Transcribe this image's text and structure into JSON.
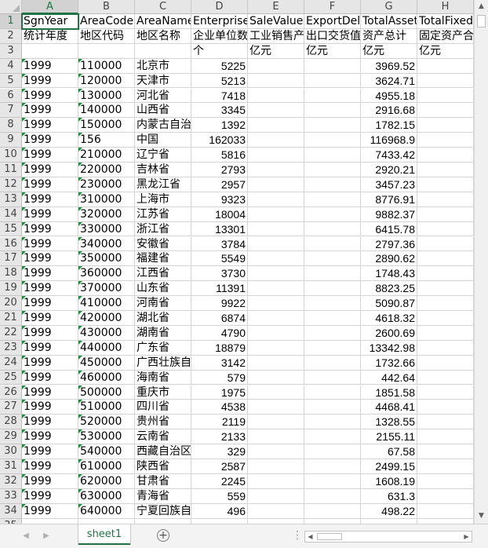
{
  "sheet": {
    "columns": [
      {
        "letter": "A",
        "selected": true
      },
      {
        "letter": "B",
        "selected": false
      },
      {
        "letter": "C",
        "selected": false
      },
      {
        "letter": "D",
        "selected": false
      },
      {
        "letter": "E",
        "selected": false
      },
      {
        "letter": "F",
        "selected": false
      },
      {
        "letter": "G",
        "selected": false
      },
      {
        "letter": "H",
        "selected": false
      }
    ],
    "header_rows": [
      [
        "SgnYear",
        "AreaCode",
        "AreaName",
        "EnterpriseN",
        "SaleValue",
        "ExportDeliv",
        "TotalAsset",
        "TotalFixed"
      ],
      [
        "统计年度",
        "地区代码",
        "地区名称",
        "企业单位数",
        "工业销售产",
        "出口交货值",
        "资产总计",
        "固定资产合"
      ],
      [
        "",
        "",
        "",
        "个",
        "亿元",
        "亿元",
        "亿元",
        "亿元"
      ]
    ],
    "data_rows": [
      [
        "1999",
        "110000",
        "北京市",
        "5225",
        "",
        "",
        "3969.52",
        ""
      ],
      [
        "1999",
        "120000",
        "天津市",
        "5213",
        "",
        "",
        "3624.71",
        ""
      ],
      [
        "1999",
        "130000",
        "河北省",
        "7418",
        "",
        "",
        "4955.18",
        ""
      ],
      [
        "1999",
        "140000",
        "山西省",
        "3345",
        "",
        "",
        "2916.68",
        ""
      ],
      [
        "1999",
        "150000",
        "内蒙古自治",
        "1392",
        "",
        "",
        "1782.15",
        ""
      ],
      [
        "1999",
        "156",
        "中国",
        "162033",
        "",
        "",
        "116968.9",
        ""
      ],
      [
        "1999",
        "210000",
        "辽宁省",
        "5816",
        "",
        "",
        "7433.42",
        ""
      ],
      [
        "1999",
        "220000",
        "吉林省",
        "2793",
        "",
        "",
        "2920.21",
        ""
      ],
      [
        "1999",
        "230000",
        "黑龙江省",
        "2957",
        "",
        "",
        "3457.23",
        ""
      ],
      [
        "1999",
        "310000",
        "上海市",
        "9323",
        "",
        "",
        "8776.91",
        ""
      ],
      [
        "1999",
        "320000",
        "江苏省",
        "18004",
        "",
        "",
        "9882.37",
        ""
      ],
      [
        "1999",
        "330000",
        "浙江省",
        "13301",
        "",
        "",
        "6415.78",
        ""
      ],
      [
        "1999",
        "340000",
        "安徽省",
        "3784",
        "",
        "",
        "2797.36",
        ""
      ],
      [
        "1999",
        "350000",
        "福建省",
        "5549",
        "",
        "",
        "2890.62",
        ""
      ],
      [
        "1999",
        "360000",
        "江西省",
        "3730",
        "",
        "",
        "1748.43",
        ""
      ],
      [
        "1999",
        "370000",
        "山东省",
        "11391",
        "",
        "",
        "8823.25",
        ""
      ],
      [
        "1999",
        "410000",
        "河南省",
        "9922",
        "",
        "",
        "5090.87",
        ""
      ],
      [
        "1999",
        "420000",
        "湖北省",
        "6874",
        "",
        "",
        "4618.32",
        ""
      ],
      [
        "1999",
        "430000",
        "湖南省",
        "4790",
        "",
        "",
        "2600.69",
        ""
      ],
      [
        "1999",
        "440000",
        "广东省",
        "18879",
        "",
        "",
        "13342.98",
        ""
      ],
      [
        "1999",
        "450000",
        "广西壮族自",
        "3142",
        "",
        "",
        "1732.66",
        ""
      ],
      [
        "1999",
        "460000",
        "海南省",
        "579",
        "",
        "",
        "442.64",
        ""
      ],
      [
        "1999",
        "500000",
        "重庆市",
        "1975",
        "",
        "",
        "1851.58",
        ""
      ],
      [
        "1999",
        "510000",
        "四川省",
        "4538",
        "",
        "",
        "4468.41",
        ""
      ],
      [
        "1999",
        "520000",
        "贵州省",
        "2119",
        "",
        "",
        "1328.55",
        ""
      ],
      [
        "1999",
        "530000",
        "云南省",
        "2133",
        "",
        "",
        "2155.11",
        ""
      ],
      [
        "1999",
        "540000",
        "西藏自治区",
        "329",
        "",
        "",
        "67.58",
        ""
      ],
      [
        "1999",
        "610000",
        "陕西省",
        "2587",
        "",
        "",
        "2499.15",
        ""
      ],
      [
        "1999",
        "620000",
        "甘肃省",
        "2245",
        "",
        "",
        "1608.19",
        ""
      ],
      [
        "1999",
        "630000",
        "青海省",
        "559",
        "",
        "",
        "631.3",
        ""
      ],
      [
        "1999",
        "640000",
        "宁夏回族自",
        "496",
        "",
        "",
        "498.22",
        ""
      ]
    ],
    "row_numbers": [
      "1",
      "2",
      "3",
      "4",
      "5",
      "6",
      "7",
      "8",
      "9",
      "10",
      "11",
      "12",
      "13",
      "14",
      "15",
      "16",
      "17",
      "18",
      "19",
      "20",
      "21",
      "22",
      "23",
      "24",
      "25",
      "26",
      "27",
      "28",
      "29",
      "30",
      "31",
      "32",
      "33",
      "34",
      "35"
    ]
  },
  "tabs": {
    "active_sheet": "sheet1",
    "add_sheet_label": "+"
  },
  "icons": {
    "scroll_up": "▲",
    "scroll_down": "▼",
    "scroll_left": "◀",
    "scroll_right": "▶",
    "nav_prev": "◀",
    "nav_next": "▶",
    "more": "⋮"
  },
  "colors": {
    "accent": "#217346",
    "header_bg": "#e6e6e6",
    "grid": "#d4d4d4"
  }
}
